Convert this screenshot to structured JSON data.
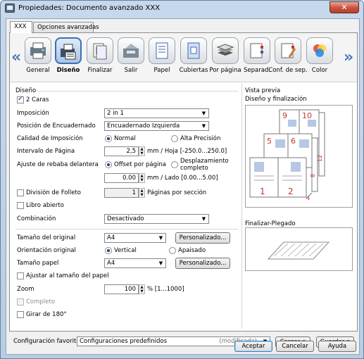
{
  "window": {
    "title": "Propiedades: Documento avanzado XXX",
    "close_glyph": "✕"
  },
  "tabs": [
    {
      "label": "XXX"
    },
    {
      "label": "Opciones avanzadas"
    }
  ],
  "toolbar": {
    "items": [
      {
        "label": "General",
        "icon": "printer-general-icon"
      },
      {
        "label": "Diseño",
        "icon": "layout-icon",
        "selected": true
      },
      {
        "label": "Finalizar",
        "icon": "finishing-icon"
      },
      {
        "label": "Salir",
        "icon": "output-tray-icon"
      },
      {
        "label": "Papel",
        "icon": "paper-icon"
      },
      {
        "label": "Cubiertas",
        "icon": "cover-icon"
      },
      {
        "label": "Por página",
        "icon": "per-page-icon"
      },
      {
        "label": "Separad.",
        "icon": "separator-icon"
      },
      {
        "label": "Conf. de sep.",
        "icon": "separator-config-icon"
      },
      {
        "label": "Color",
        "icon": "color-icon"
      }
    ],
    "left_arrow": "«",
    "right_arrow": "»"
  },
  "layout": {
    "section_title": "Diseño",
    "duplex": {
      "label": "2 Caras",
      "checked": true
    },
    "imposition": {
      "label": "Imposición",
      "value": "2 in 1"
    },
    "binding": {
      "label": "Posición de Encuadernado",
      "value": "Encuadernado Izquierda"
    },
    "quality": {
      "label": "Calidad de Imposición",
      "opt1": "Normal",
      "opt2": "Alta Precisión",
      "selected": "Normal"
    },
    "page_interval": {
      "label": "Intervalo de Página",
      "value": "2,5",
      "unit": "mm / Hoja [-250.0...250.0]"
    },
    "trim": {
      "label": "Ajuste de rebaba delantera",
      "opt1": "Offset por página",
      "opt2a": "Desplazamiento",
      "opt2b": "completo",
      "selected": "Offset por página",
      "value": "0.00",
      "unit": "mm / Lado [0.00...5.00]"
    },
    "booklet": {
      "label": "División de Folleto",
      "value": "1",
      "unit": "Páginas por sección",
      "checked": false
    },
    "open_book": {
      "label": "Libro abierto",
      "checked": false
    },
    "combination": {
      "label": "Combinación",
      "value": "Desactivado"
    }
  },
  "paper": {
    "original_size": {
      "label": "Tamaño del original",
      "value": "A4",
      "button": "Personalizado..."
    },
    "orientation": {
      "label": "Orientación original",
      "opt1": "Vertical",
      "opt2": "Apaisado",
      "selected": "Vertical"
    },
    "paper_size": {
      "label": "Tamaño papel",
      "value": "A4",
      "button": "Personalizado..."
    },
    "fit": {
      "label": "Ajustar al tamaño del papel",
      "checked": false
    },
    "zoom": {
      "label": "Zoom",
      "value": "100",
      "unit": "% [1...1000]"
    },
    "full": {
      "label": "Completo",
      "checked": false
    },
    "rotate": {
      "label": "Girar de 180°",
      "checked": false
    }
  },
  "preview": {
    "section_title": "Vista previa",
    "subtitle": "Diseño y finalización",
    "page_numbers": [
      "1",
      "2",
      "5",
      "6",
      "9",
      "10",
      "4",
      "8",
      "12"
    ],
    "fold_title": "Finalizar-Plegado"
  },
  "favorites": {
    "label": "Configuración favorita",
    "value": "Configuraciones predefinidos",
    "status": "(modificada)",
    "load_button": "Cargar",
    "save_button": "Guardar"
  },
  "footer": {
    "ok": "Aceptar",
    "cancel": "Cancelar",
    "help": "Ayuda"
  },
  "colors": {
    "accent": "#3b6fb5",
    "page_number": "#c0392b"
  }
}
